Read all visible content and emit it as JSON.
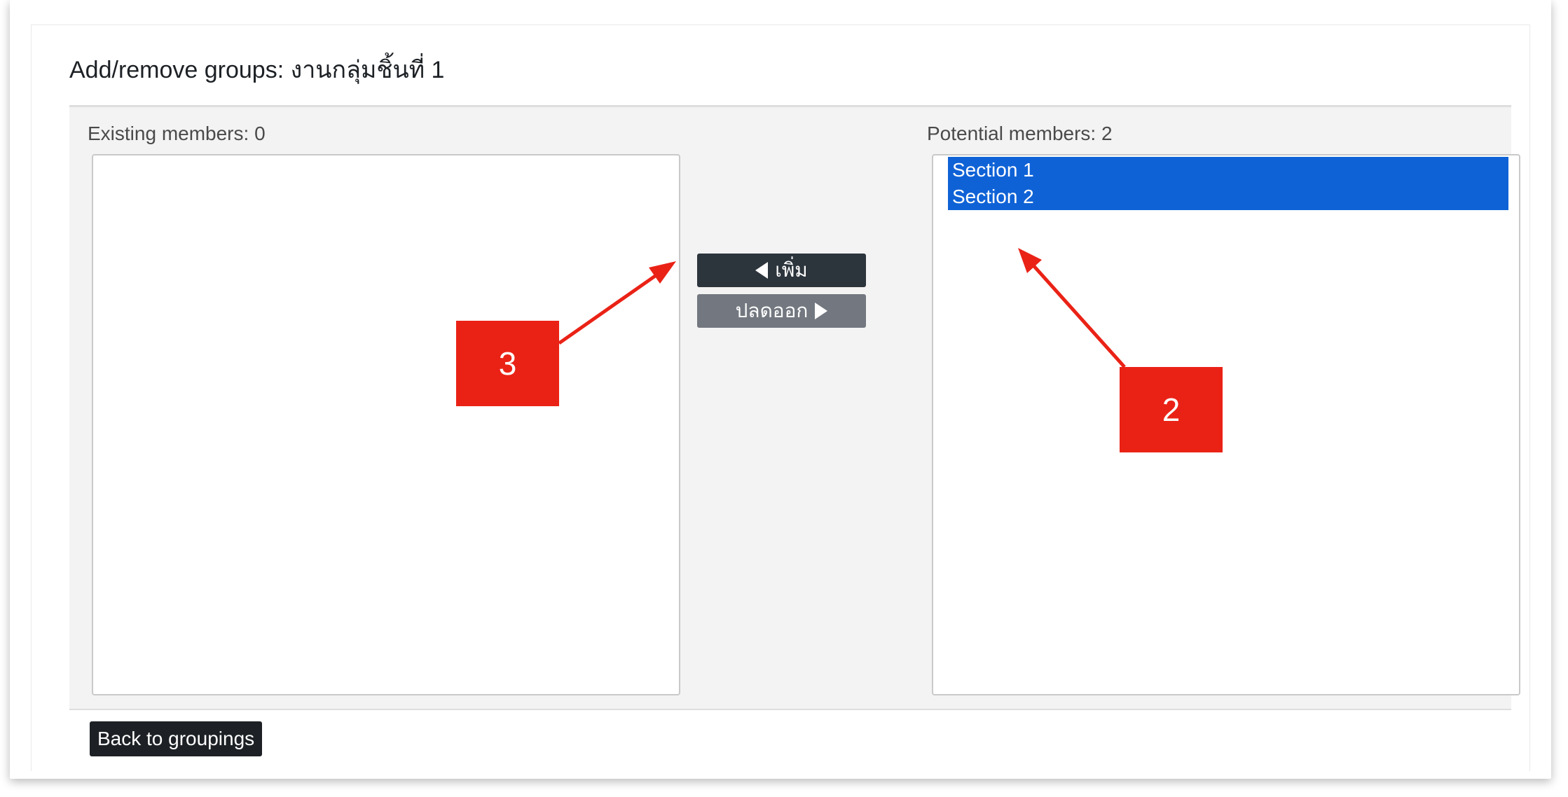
{
  "page": {
    "title": "Add/remove groups: งานกลุ่มชิ้นที่ 1"
  },
  "existing": {
    "label": "Existing members: 0",
    "options": []
  },
  "potential": {
    "label": "Potential members: 2",
    "options": [
      {
        "label": "Section 1",
        "selected": true
      },
      {
        "label": "Section 2",
        "selected": true
      }
    ]
  },
  "actions": {
    "add_label": "เพิ่ม",
    "remove_label": "ปลดออก"
  },
  "footer": {
    "back_label": "Back to groupings"
  },
  "annotations": {
    "marker_2": "2",
    "marker_3": "3",
    "color": "#ea2216"
  },
  "colors": {
    "selection": "#0f62d6",
    "add_button": "#2c343c",
    "remove_button": "#737880"
  }
}
